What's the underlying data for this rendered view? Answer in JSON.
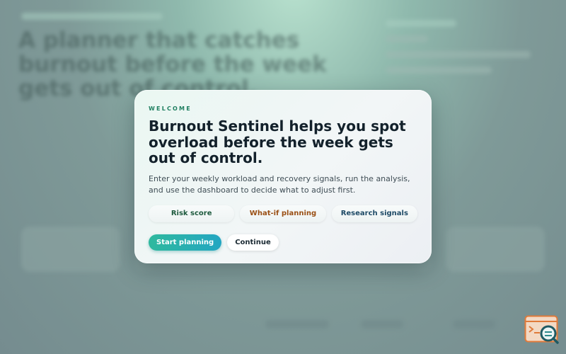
{
  "modal": {
    "eyebrow": "WELCOME",
    "title": "Burnout Sentinel helps you spot overload before the week gets out of control.",
    "description": "Enter your weekly workload and recovery signals, run the analysis, and use the dashboard to decide what to adjust first.",
    "chips": [
      {
        "label": "Risk score",
        "color": "#1e5a3e"
      },
      {
        "label": "What-if planning",
        "color": "#9a4f14"
      },
      {
        "label": "Research signals",
        "color": "#1e4a66"
      }
    ],
    "primary_button": "Start planning",
    "secondary_button": "Continue"
  },
  "background": {
    "hero_text": "A planner that catches burnout before the week gets out of control."
  },
  "colors": {
    "accent_green": "#1f7f60",
    "primary_gradient_start": "#2fb99e",
    "primary_gradient_end": "#23a6c2",
    "widget_orange": "#e07a3a",
    "widget_teal": "#2e8a8c"
  },
  "icons": {
    "corner_widget": "terminal-search-icon"
  }
}
